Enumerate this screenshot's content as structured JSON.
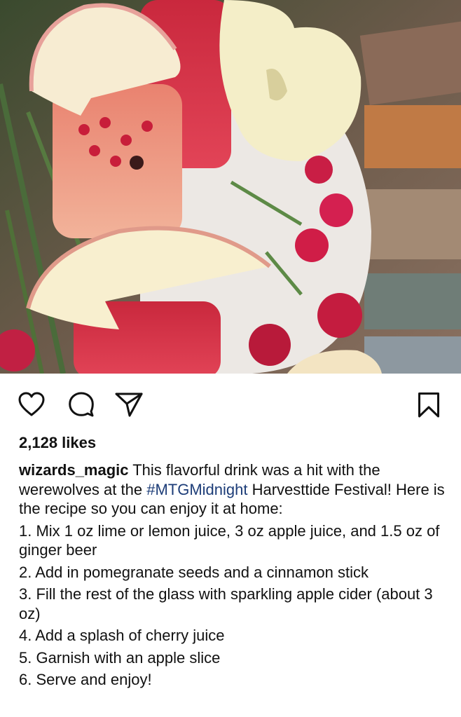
{
  "post": {
    "image_alt": "Pomegranate apple cocktails with apple slices and red carnations",
    "likes": "2,128 likes",
    "username": "wizards_magic",
    "caption_part1": "This flavorful drink was a hit with the werewolves at the ",
    "hashtag": "#MTGMidnight",
    "caption_part2": " Harvesttide Festival! Here is the recipe so you can enjoy it at home:",
    "steps": [
      "1. Mix 1 oz lime or lemon juice, 3 oz apple juice, and 1.5 oz of ginger beer",
      "2. Add in pomegranate seeds and a cinnamon stick",
      "3. Fill the rest of the glass with sparkling apple cider (about 3 oz)",
      "4. Add a splash of cherry juice",
      "5. Garnish with an apple slice",
      "6. Serve and enjoy!"
    ]
  },
  "icons": {
    "like": "heart-icon",
    "comment": "comment-bubble-icon",
    "share": "paper-plane-icon",
    "save": "bookmark-icon"
  },
  "colors": {
    "hashtag": "#1d3d78",
    "text": "#111111"
  }
}
